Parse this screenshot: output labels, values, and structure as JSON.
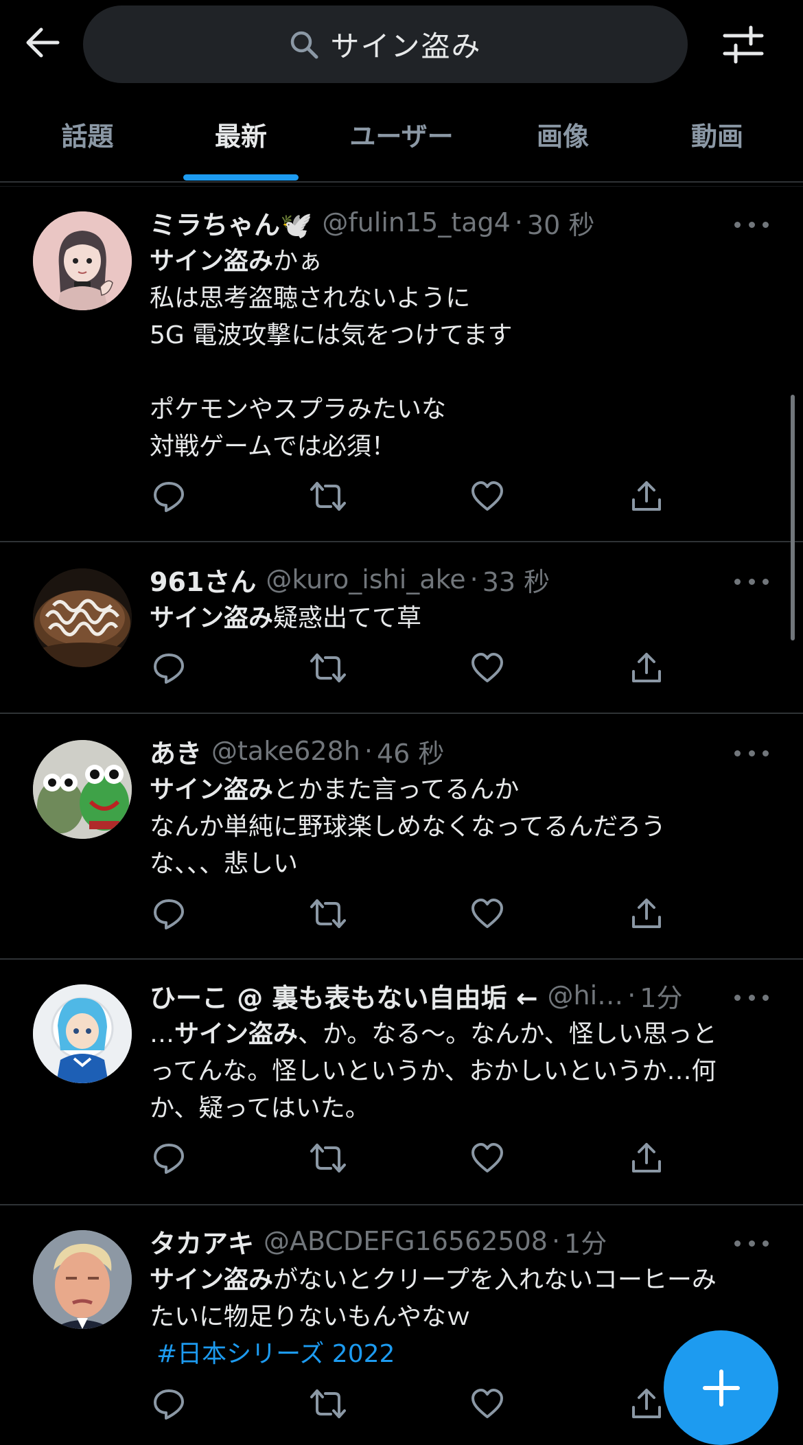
{
  "search": {
    "query": "サイン盗み"
  },
  "tabs": [
    {
      "label": "話題"
    },
    {
      "label": "最新"
    },
    {
      "label": "ユーザー"
    },
    {
      "label": "画像"
    },
    {
      "label": "動画"
    }
  ],
  "active_tab": "最新",
  "tweets": [
    {
      "name": "ミラちゃん🕊️",
      "handle": "@fulin15_tag4",
      "time": "30 秒",
      "highlight": "サイン盗み",
      "text": [
        "かぁ",
        "私は思考盗聴されないように",
        "5G 電波攻撃には気をつけてます",
        "",
        "ポケモンやスプラみたいな",
        "対戦ゲームでは必須！"
      ]
    },
    {
      "name": "961さん",
      "handle": "@kuro_ishi_ake",
      "time": "33 秒",
      "highlight": "サイン盗み",
      "text": [
        "疑惑出てて草"
      ]
    },
    {
      "name": "あき",
      "handle": "@take628h",
      "time": "46 秒",
      "highlight": "サイン盗み",
      "text": [
        "とかまた言ってるんか",
        "なんか単純に野球楽しめなくなってるんだろう",
        "な、、、悲しい"
      ]
    },
    {
      "name": "ひーこ @ 裏も表もない自由垢 ←",
      "handle": "@hi…",
      "time": "1分",
      "prefix": "…",
      "highlight": "サイン盗み",
      "text": [
        "、か。なる〜。なんか、怪しい思っと",
        "ってんな。怪しいというか、おかしいというか…何",
        "か、疑ってはいた。"
      ]
    },
    {
      "name": "タカアキ",
      "handle": "@ABCDEFG16562508",
      "time": "1分",
      "highlight": "サイン盗み",
      "text": [
        "がないとクリープを入れないコーヒーみ",
        "たいに物足りないもんやなｗ"
      ],
      "hashtag": "#日本シリーズ 2022"
    }
  ],
  "colors": {
    "background": "#000000",
    "accent": "#1d9bf0",
    "muted": "#71767b",
    "search_bg": "#202327"
  },
  "icons": [
    "back-arrow-icon",
    "search-icon",
    "filter-icon",
    "reply-icon",
    "retweet-icon",
    "like-icon",
    "share-icon",
    "more-icon",
    "compose-plus-icon"
  ]
}
